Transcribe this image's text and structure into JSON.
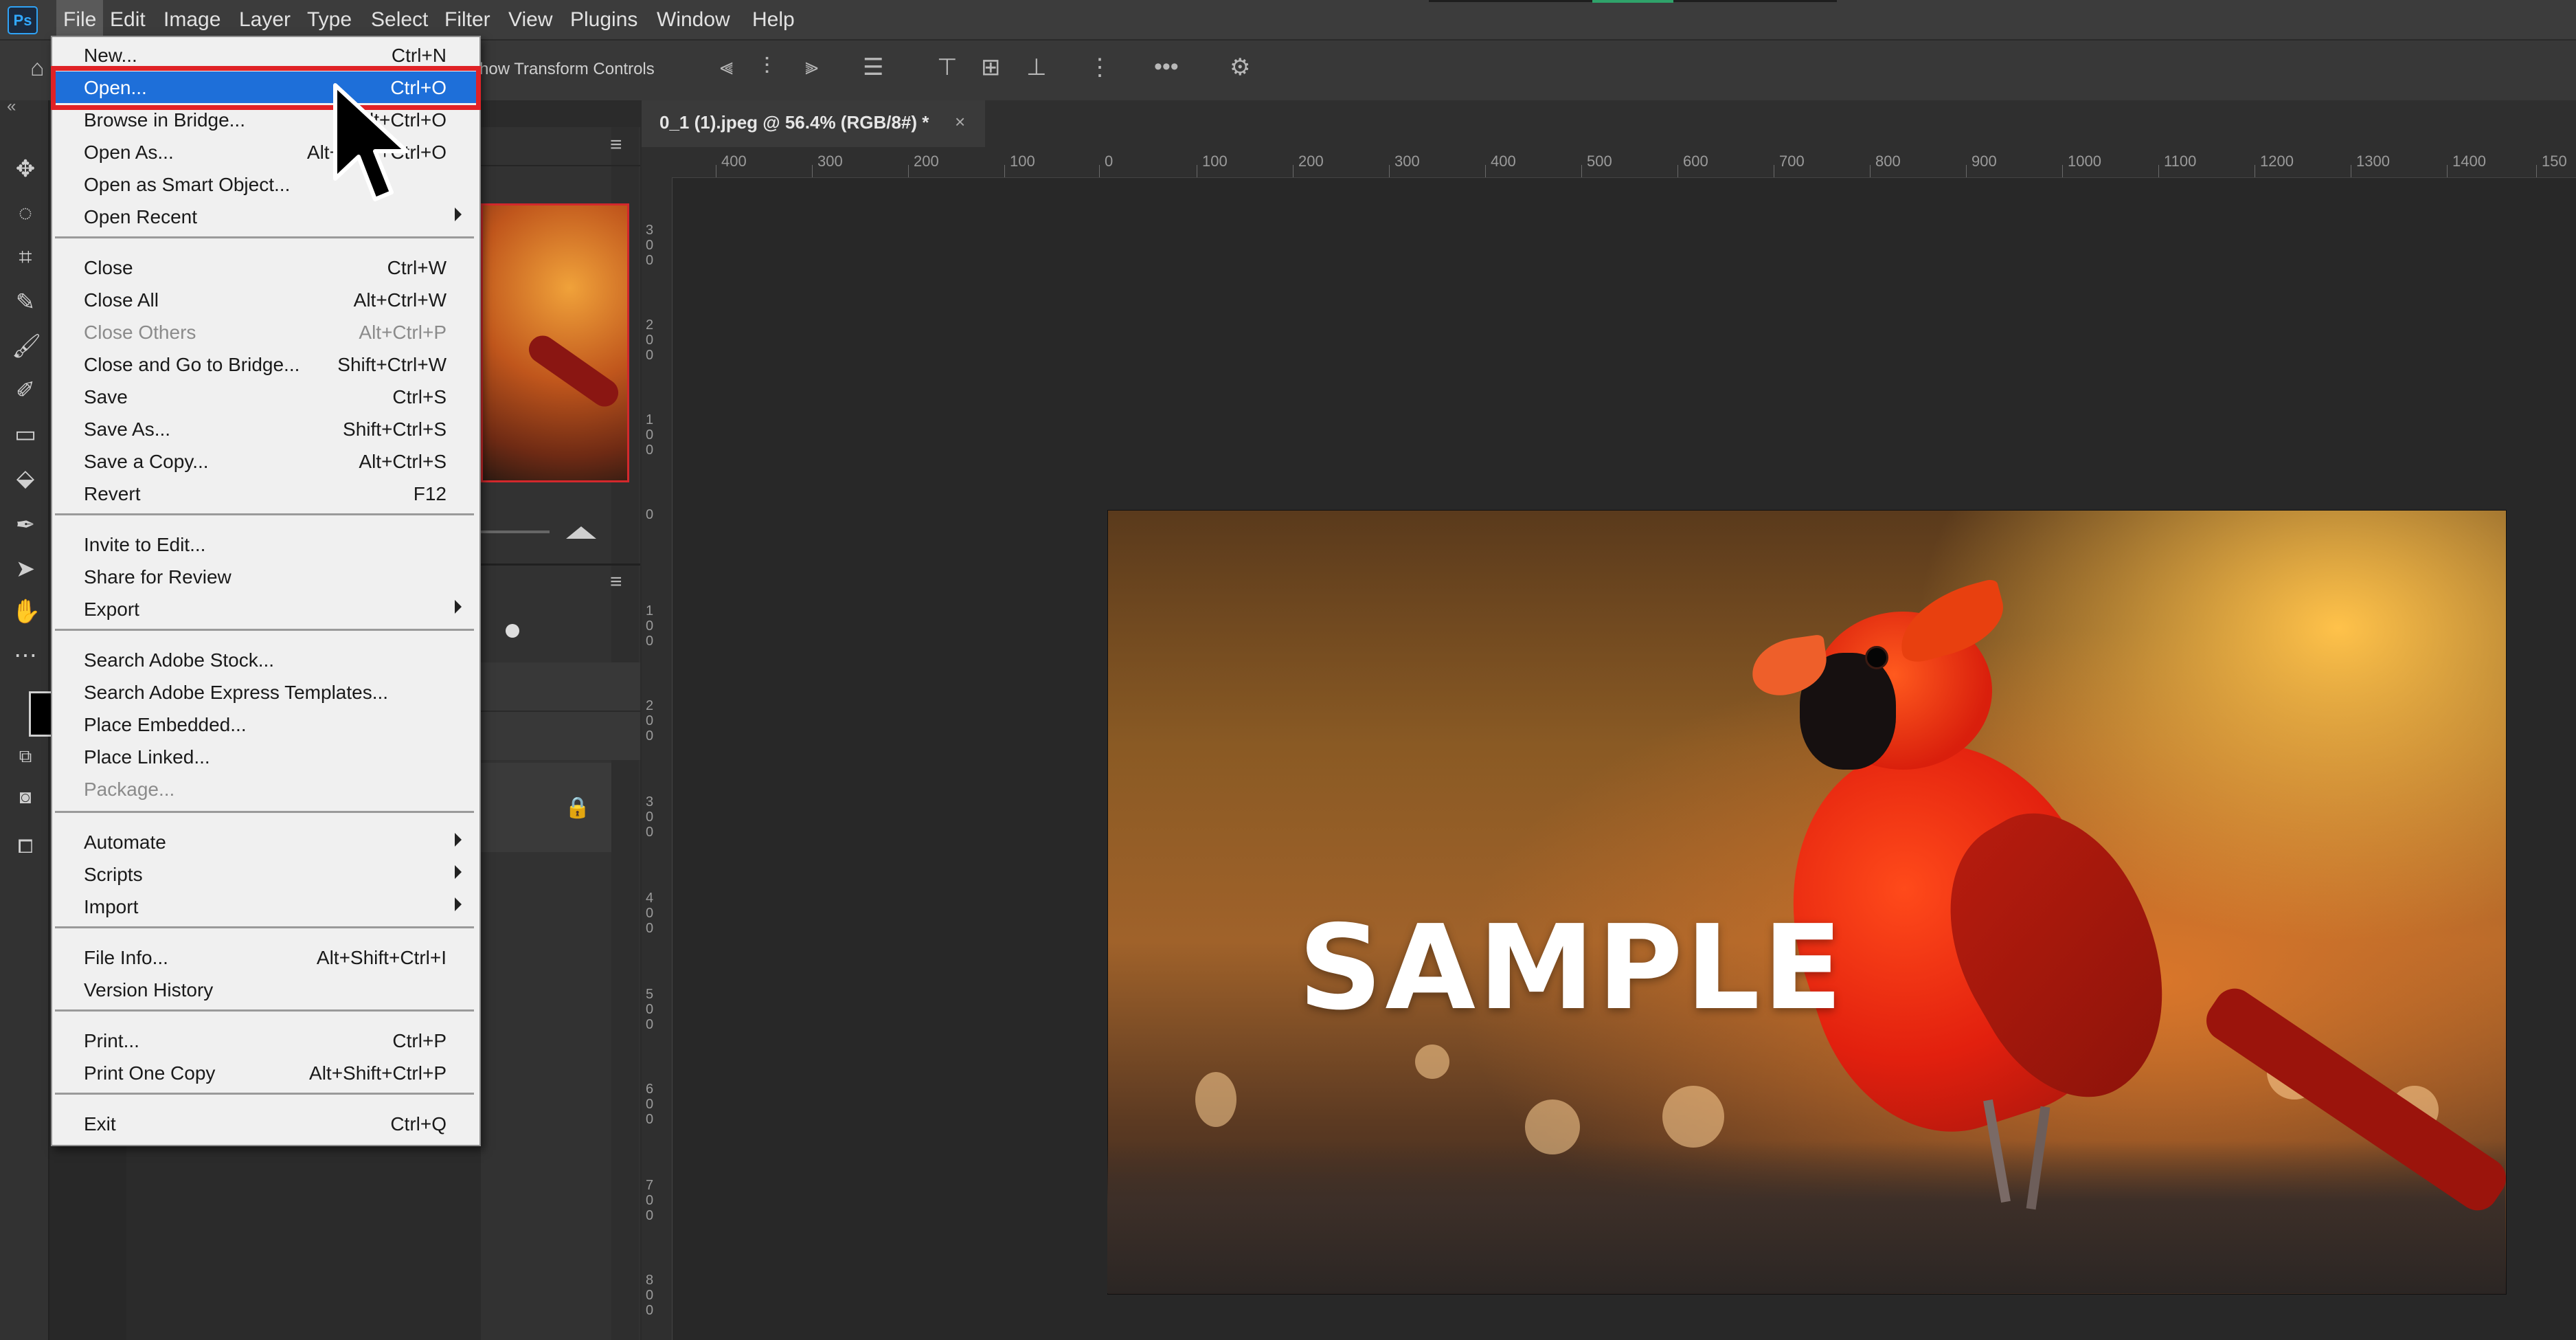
{
  "app": {
    "logo": "Ps"
  },
  "menubar": {
    "items": [
      "File",
      "Edit",
      "Image",
      "Layer",
      "Type",
      "Select",
      "Filter",
      "View",
      "Plugins",
      "Window",
      "Help"
    ],
    "active": "File"
  },
  "options_bar": {
    "transform_controls_label": "how Transform Controls"
  },
  "document": {
    "tab_label": "0_1 (1).jpeg @ 56.4% (RGB/8#) *",
    "tab_close": "×",
    "watermark": "SAMPLE"
  },
  "rulers": {
    "horizontal": [
      "400",
      "300",
      "200",
      "100",
      "0",
      "100",
      "200",
      "300",
      "400",
      "500",
      "600",
      "700",
      "800",
      "900",
      "1000",
      "1100",
      "1200",
      "1300",
      "1400",
      "150"
    ],
    "vertical": [
      "300",
      "200",
      "100",
      "0",
      "100",
      "200",
      "300",
      "400",
      "500",
      "600",
      "700",
      "800"
    ]
  },
  "file_menu": {
    "items": [
      {
        "label": "New...",
        "shortcut": "Ctrl+N"
      },
      {
        "label": "Open...",
        "shortcut": "Ctrl+O",
        "highlighted": true
      },
      {
        "label": "Browse in Bridge...",
        "shortcut": "Alt+Ctrl+O"
      },
      {
        "label": "Open As...",
        "shortcut": "Alt+Shift+Ctrl+O"
      },
      {
        "label": "Open as Smart Object...",
        "shortcut": ""
      },
      {
        "label": "Open Recent",
        "shortcut": "",
        "submenu": true
      },
      {
        "label": "Close",
        "shortcut": "Ctrl+W"
      },
      {
        "label": "Close All",
        "shortcut": "Alt+Ctrl+W"
      },
      {
        "label": "Close Others",
        "shortcut": "Alt+Ctrl+P",
        "disabled": true
      },
      {
        "label": "Close and Go to Bridge...",
        "shortcut": "Shift+Ctrl+W"
      },
      {
        "label": "Save",
        "shortcut": "Ctrl+S"
      },
      {
        "label": "Save As...",
        "shortcut": "Shift+Ctrl+S"
      },
      {
        "label": "Save a Copy...",
        "shortcut": "Alt+Ctrl+S"
      },
      {
        "label": "Revert",
        "shortcut": "F12"
      },
      {
        "label": "Invite to Edit...",
        "shortcut": ""
      },
      {
        "label": "Share for Review",
        "shortcut": ""
      },
      {
        "label": "Export",
        "shortcut": "",
        "submenu": true
      },
      {
        "label": "Search Adobe Stock...",
        "shortcut": ""
      },
      {
        "label": "Search Adobe Express Templates...",
        "shortcut": ""
      },
      {
        "label": "Place Embedded...",
        "shortcut": ""
      },
      {
        "label": "Place Linked...",
        "shortcut": ""
      },
      {
        "label": "Package...",
        "shortcut": "",
        "disabled": true
      },
      {
        "label": "Automate",
        "shortcut": "",
        "submenu": true
      },
      {
        "label": "Scripts",
        "shortcut": "",
        "submenu": true
      },
      {
        "label": "Import",
        "shortcut": "",
        "submenu": true
      },
      {
        "label": "File Info...",
        "shortcut": "Alt+Shift+Ctrl+I"
      },
      {
        "label": "Version History",
        "shortcut": ""
      },
      {
        "label": "Print...",
        "shortcut": "Ctrl+P"
      },
      {
        "label": "Print One Copy",
        "shortcut": "Alt+Shift+Ctrl+P"
      },
      {
        "label": "Exit",
        "shortcut": "Ctrl+Q"
      }
    ]
  },
  "toolbar": {
    "tools": [
      "move-icon",
      "lasso-icon",
      "crop-icon",
      "eyedropper-icon",
      "brush-icon",
      "history-brush-icon",
      "gradient-icon",
      "fill-icon",
      "pen-icon",
      "path-select-icon",
      "hand-icon",
      "more-icon"
    ]
  },
  "colors": {
    "highlight": "#1e6fd9",
    "callout_box": "#e02226",
    "menu_bg": "#f0f0f0"
  }
}
